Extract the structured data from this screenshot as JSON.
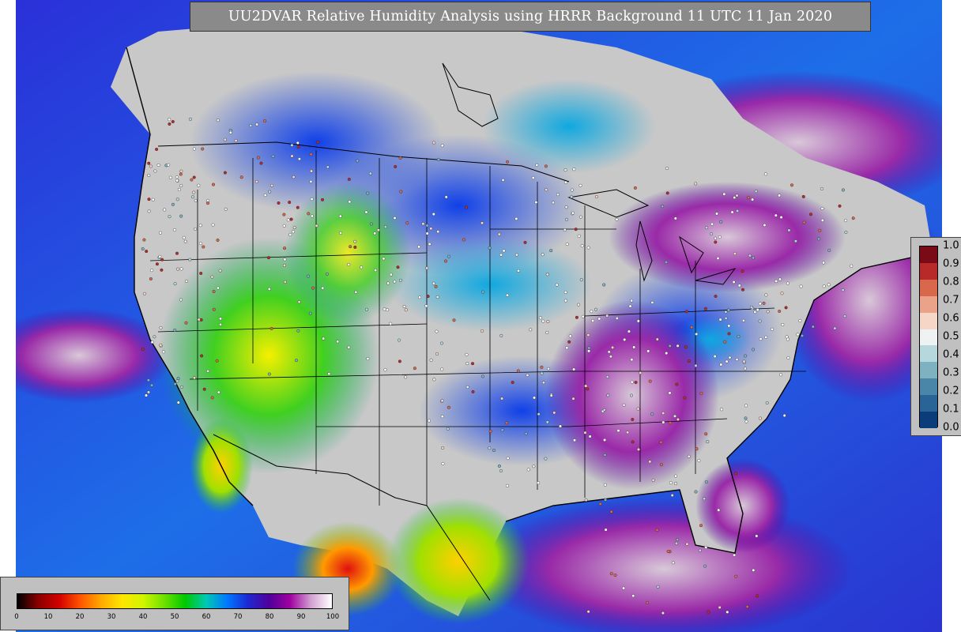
{
  "title": "UU2DVAR Relative Humidity Analysis using HRRR Background 11 UTC 11 Jan 2020",
  "rh_colorbar": {
    "ticks": [
      "0",
      "10",
      "20",
      "30",
      "40",
      "50",
      "60",
      "70",
      "80",
      "90",
      "100"
    ],
    "colors": [
      "#000000",
      "#8b0000",
      "#d40000",
      "#ff5500",
      "#ffaa00",
      "#ffe600",
      "#d2f500",
      "#6ee100",
      "#00c800",
      "#00c8b4",
      "#0078ff",
      "#1e28d2",
      "#50009b",
      "#a000a0",
      "#d2a0d2",
      "#ffffff"
    ]
  },
  "innovation_colorbar": {
    "ticks": [
      "0.0",
      "0.1",
      "0.2",
      "0.3",
      "0.4",
      "0.5",
      "0.6",
      "0.7",
      "0.8",
      "0.9",
      "1.0"
    ],
    "colors": [
      "#0b3d7a",
      "#2a6496",
      "#4a86a8",
      "#7fb2c0",
      "#b6d8dc",
      "#eef2f2",
      "#f6d6c6",
      "#eaa388",
      "#d9674c",
      "#b82a2a",
      "#7a0a16"
    ]
  },
  "map": {
    "land_color": "#c8c8c8",
    "ocean_color": "#1e3ce0"
  }
}
